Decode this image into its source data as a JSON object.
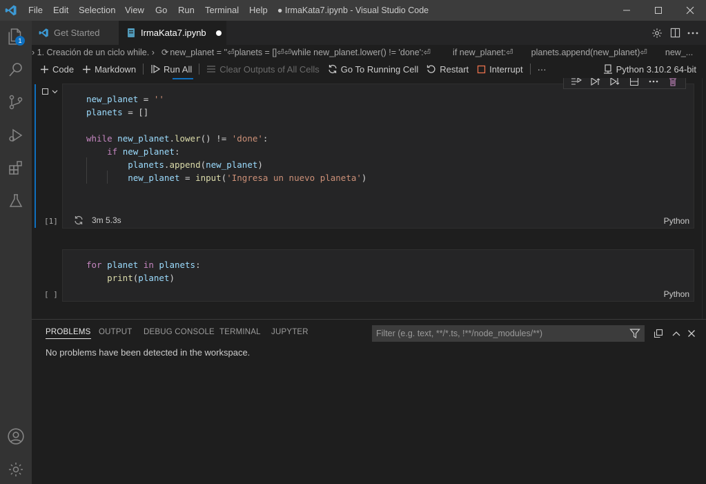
{
  "titlebar": {
    "menu": [
      "File",
      "Edit",
      "Selection",
      "View",
      "Go",
      "Run",
      "Terminal",
      "Help"
    ],
    "title": "● IrmaKata7.ipynb - Visual Studio Code",
    "brand_color": "#3c99d4"
  },
  "activitybar": {
    "items": [
      "explorer",
      "search",
      "source-control",
      "run-debug",
      "extensions",
      "testing"
    ],
    "explorer_badge": "1",
    "bottom": [
      "accounts",
      "manage"
    ]
  },
  "tabs": [
    {
      "label": "Get Started",
      "active": false
    },
    {
      "label": "IrmaKata7.ipynb",
      "active": true,
      "dirty": true
    }
  ],
  "breadcrumb": {
    "items": [
      "› 1. Creación de un ciclo while. ›",
      "new_planet = ''⏎planets = []⏎⏎while new_planet.lower() != 'done':⏎",
      "if new_planet:⏎",
      "planets.append(new_planet)⏎",
      "new_..."
    ]
  },
  "toolbar": {
    "code": "Code",
    "markdown": "Markdown",
    "run_all": "Run All",
    "clear_outputs": "Clear Outputs of All Cells",
    "go_to_running": "Go To Running Cell",
    "restart": "Restart",
    "interrupt": "Interrupt",
    "more": "···",
    "kernel": "Python 3.10.2 64-bit"
  },
  "cells": [
    {
      "exec_count": "[1]",
      "status": "3m 5.3s",
      "language": "Python"
    },
    {
      "exec_count": "[ ]",
      "language": "Python"
    }
  ],
  "panel": {
    "tabs": [
      "PROBLEMS",
      "OUTPUT",
      "DEBUG CONSOLE",
      "TERMINAL",
      "JUPYTER"
    ],
    "active_tab": "PROBLEMS",
    "filter_placeholder": "Filter (e.g. text, **/*.ts, !**/node_modules/**)",
    "message": "No problems have been detected in the workspace."
  }
}
